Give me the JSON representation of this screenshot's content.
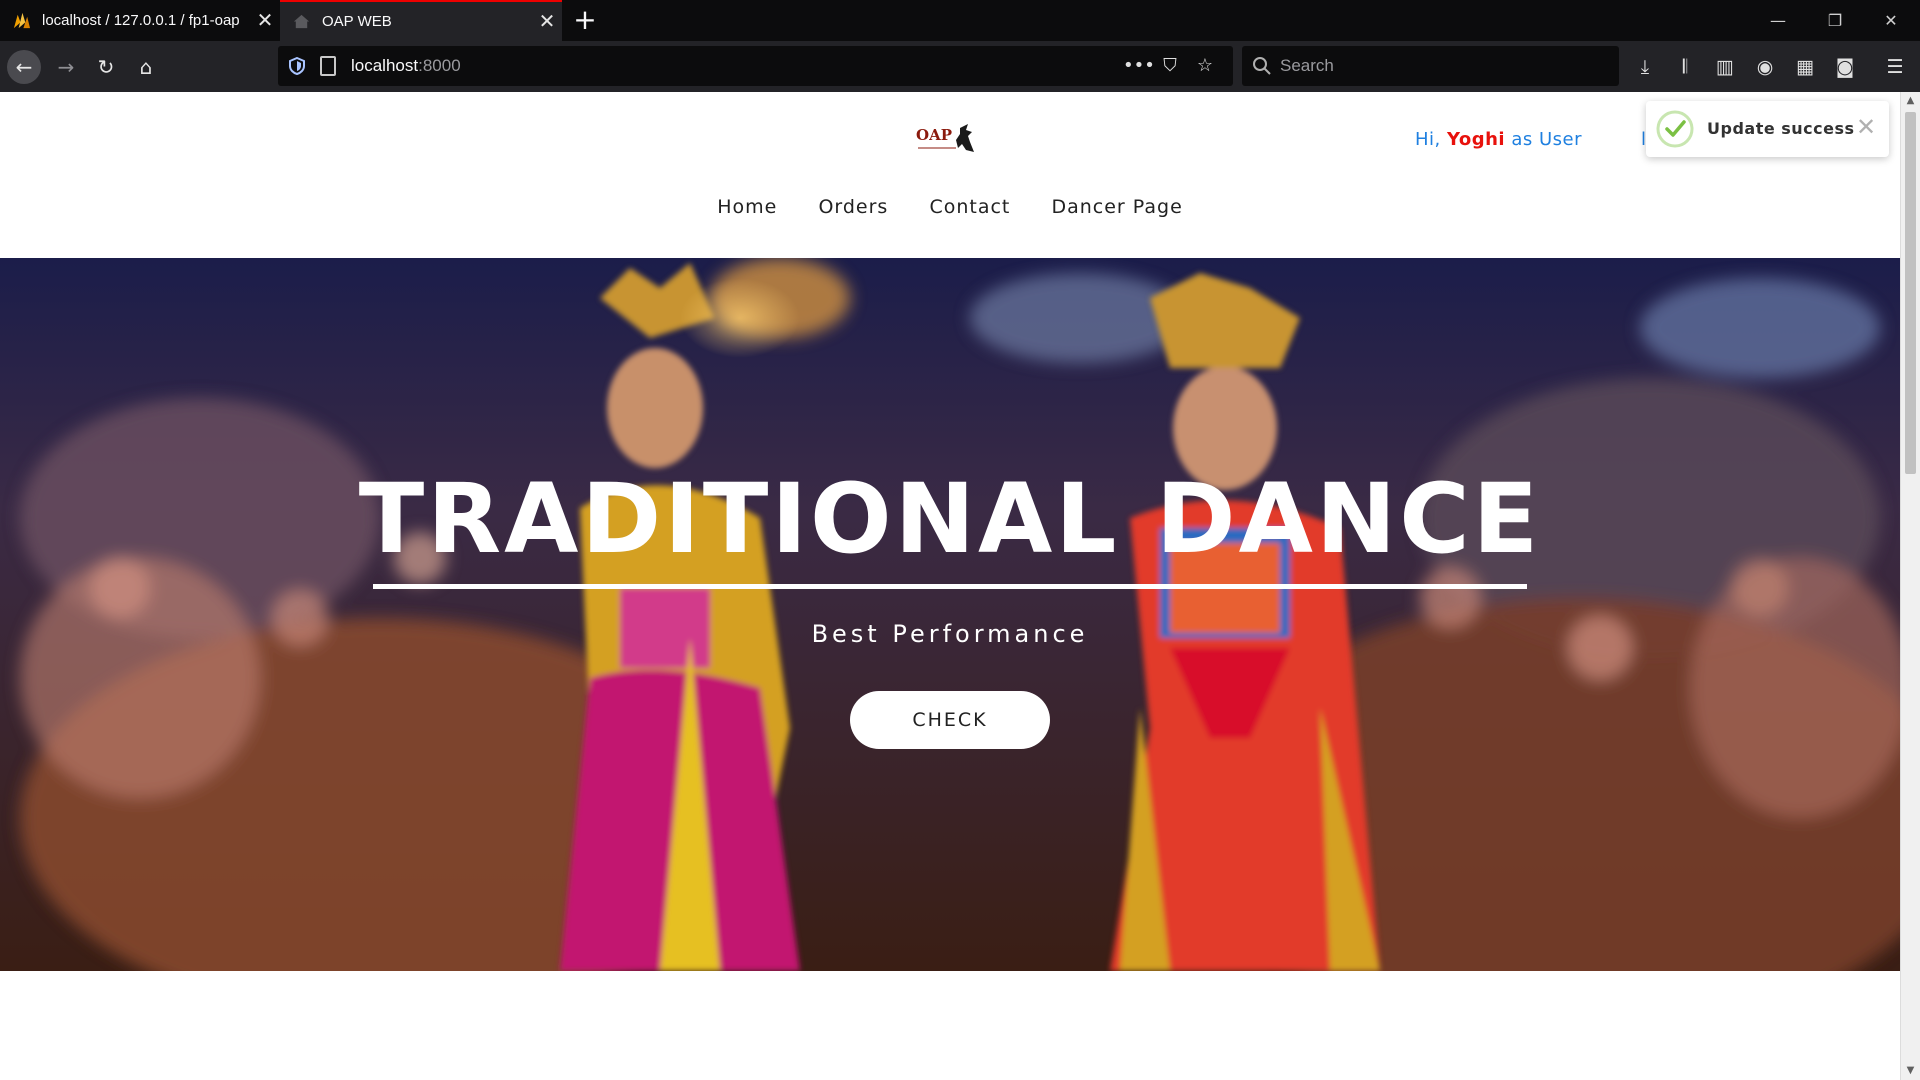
{
  "browser": {
    "tabs": [
      {
        "title": "localhost / 127.0.0.1 / fp1-oap",
        "active": false
      },
      {
        "title": "OAP WEB",
        "active": true
      }
    ],
    "new_tab_icon": "plus-icon",
    "url_host": "localhost",
    "url_port": ":8000",
    "search_placeholder": "Search",
    "accent_color": "#e00000"
  },
  "site": {
    "logo_text": "OAP",
    "nav": [
      "Home",
      "Orders",
      "Contact",
      "Dancer Page"
    ],
    "greeting": {
      "prefix": "Hi, ",
      "name": "Yoghi",
      "suffix": " as User",
      "cut_link": "l",
      "name_color": "#e8110c",
      "text_color": "#1f80e0"
    },
    "hero": {
      "title": "TRADITIONAL DANCE",
      "subtitle": "Best Performance",
      "button": "CHECK"
    }
  },
  "toast": {
    "message": "Update success",
    "status": "success",
    "color": "#7bc043"
  }
}
